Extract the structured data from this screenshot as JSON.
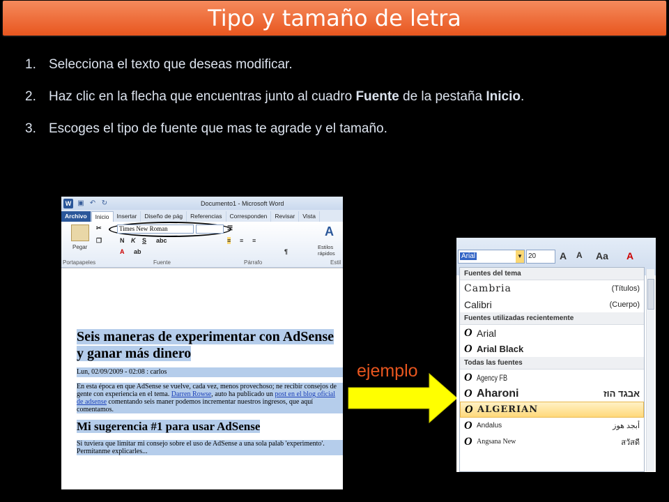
{
  "slide": {
    "title": "Tipo y tamaño de letra",
    "accent": "#E8561F",
    "steps": [
      {
        "num": "1.",
        "text_a": "Selecciona el texto que deseas modificar.",
        "bold_a": "",
        "text_b": "",
        "bold_b": "",
        "text_c": ""
      },
      {
        "num": "2.",
        "text_a": "Haz clic en la flecha que encuentras junto al cuadro ",
        "bold_a": "Fuente",
        "text_b": " de la pestaña ",
        "bold_b": "Inicio",
        "text_c": "."
      },
      {
        "num": "3.",
        "text_a": "Escoges el tipo de fuente que mas te agrade y el tamaño.",
        "bold_a": "",
        "text_b": "",
        "bold_b": "",
        "text_c": ""
      }
    ],
    "ejemplo_label": "ejemplo"
  },
  "word": {
    "window_title": "Documento1 - Microsoft Word",
    "tabs": [
      "Archivo",
      "Inicio",
      "Insertar",
      "Diseño de pág",
      "Referencias",
      "Corresponden",
      "Revisar",
      "Vista"
    ],
    "font_name": "Times New Roman",
    "paste_label": "Pegar",
    "styles_label": "Estilos rápidos",
    "groups": [
      "Portapapeles",
      "Fuente",
      "Párrafo",
      "Estil"
    ],
    "doc": {
      "heading1": "Seis maneras de experimentar con AdSense y ganar más dinero",
      "meta": "Lun, 02/09/2009 - 02:08 : carlos",
      "para1_a": "En esta época en que AdSense se vuelve, cada vez, menos provechoso; ne recibir consejos de gente con experiencia en el tema. ",
      "para1_link1": "Darren Rowse",
      "para1_b": ", auto ha publicado un ",
      "para1_link2": "post en el blog oficial de adsense",
      "para1_c": " comentando seis maner podemos incrementar nuestros ingresos, que aquí comentamos.",
      "heading2": "Mi sugerencia #1 para usar AdSense",
      "para2": "Si tuviera que limitar mi consejo sobre el uso de AdSense a una sola palab 'experimento'. Permítanme explicarles..."
    }
  },
  "font_dropdown": {
    "current_font": "Arial",
    "current_size": "20",
    "sections": {
      "theme": "Fuentes del tema",
      "recent": "Fuentes utilizadas recientemente",
      "all": "Todas las fuentes"
    },
    "theme_fonts": [
      {
        "name": "Cambria",
        "tag": "(Títulos)"
      },
      {
        "name": "Calibri",
        "tag": "(Cuerpo)"
      }
    ],
    "recent_fonts": [
      "Arial",
      "Arial Black"
    ],
    "all_fonts": [
      {
        "name": "Agency FB",
        "sample": ""
      },
      {
        "name": "Aharoni",
        "sample": "אבגד הוז"
      },
      {
        "name": "ALGERIAN",
        "sample": ""
      },
      {
        "name": "Andalus",
        "sample": "أبجد هوز"
      },
      {
        "name": "Angsana New",
        "sample": "สวัสดี"
      }
    ]
  }
}
